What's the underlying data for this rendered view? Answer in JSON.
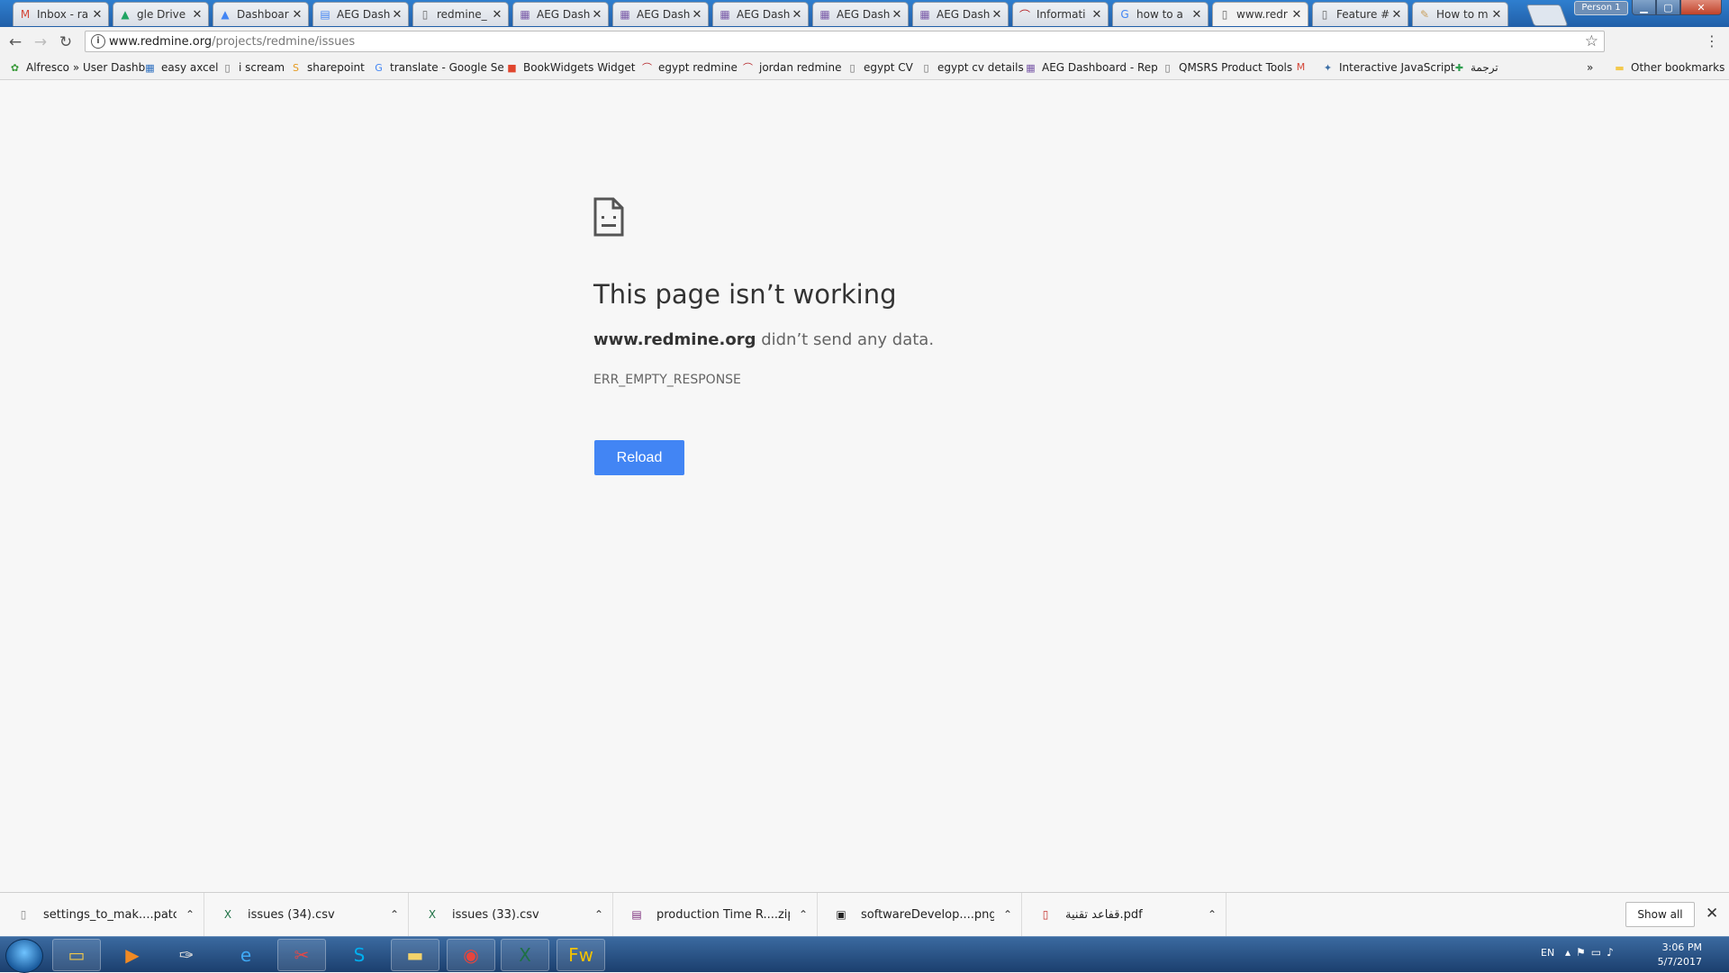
{
  "window": {
    "profile_label": "Person 1"
  },
  "tabs": [
    {
      "title": "Inbox - ra",
      "icon": "gmail-icon",
      "glyph": "M",
      "color": "#d44638",
      "active": false
    },
    {
      "title": "gle Drive",
      "icon": "google-drive-icon",
      "glyph": "▲",
      "color": "#1fa463",
      "active": false
    },
    {
      "title": "Dashboar",
      "icon": "google-drive-icon",
      "glyph": "▲",
      "color": "#4285f4",
      "active": false
    },
    {
      "title": "AEG Dash",
      "icon": "google-docs-icon",
      "glyph": "▤",
      "color": "#4285f4",
      "active": false
    },
    {
      "title": "redmine_",
      "icon": "page-icon",
      "glyph": "▯",
      "color": "#666666",
      "active": false
    },
    {
      "title": "AEG Dash",
      "icon": "dashboard-icon",
      "glyph": "▦",
      "color": "#7a5aa8",
      "active": false
    },
    {
      "title": "AEG Dash",
      "icon": "dashboard-icon",
      "glyph": "▦",
      "color": "#7a5aa8",
      "active": false
    },
    {
      "title": "AEG Dash",
      "icon": "dashboard-icon",
      "glyph": "▦",
      "color": "#7a5aa8",
      "active": false
    },
    {
      "title": "AEG Dash",
      "icon": "dashboard-icon",
      "glyph": "▦",
      "color": "#7a5aa8",
      "active": false
    },
    {
      "title": "AEG Dash",
      "icon": "dashboard-icon",
      "glyph": "▦",
      "color": "#7a5aa8",
      "active": false
    },
    {
      "title": "Informati",
      "icon": "redmine-icon",
      "glyph": "⌒",
      "color": "#b32024",
      "active": false
    },
    {
      "title": "how to a",
      "icon": "google-icon",
      "glyph": "G",
      "color": "#4285f4",
      "active": false
    },
    {
      "title": "www.redr",
      "icon": "page-icon",
      "glyph": "▯",
      "color": "#666666",
      "active": true
    },
    {
      "title": "Feature #",
      "icon": "page-icon",
      "glyph": "▯",
      "color": "#666666",
      "active": false
    },
    {
      "title": "How to m",
      "icon": "blog-icon",
      "glyph": "✎",
      "color": "#c8a060",
      "active": false
    }
  ],
  "toolbar": {
    "url_host": "www.redmine.org",
    "url_path": "/projects/redmine/issues"
  },
  "bookmarks": [
    {
      "label": "Alfresco » User Dashb",
      "icon": "alfresco-icon",
      "glyph": "✿",
      "color": "#3a9b3a"
    },
    {
      "label": "easy axcel",
      "icon": "excel-sheet-icon",
      "glyph": "▦",
      "color": "#2d6fbf"
    },
    {
      "label": "i scream",
      "icon": "page-icon",
      "glyph": "▯",
      "color": "#666666"
    },
    {
      "label": "sharepoint",
      "icon": "sharepoint-icon",
      "glyph": "S",
      "color": "#e69a1f"
    },
    {
      "label": "translate - Google Se",
      "icon": "google-icon",
      "glyph": "G",
      "color": "#4285f4"
    },
    {
      "label": "BookWidgets Widget",
      "icon": "bookwidgets-icon",
      "glyph": "■",
      "color": "#e0452d"
    },
    {
      "label": "egypt redmine",
      "icon": "redmine-icon",
      "glyph": "⌒",
      "color": "#b32024"
    },
    {
      "label": "jordan redmine",
      "icon": "redmine-icon",
      "glyph": "⌒",
      "color": "#b32024"
    },
    {
      "label": "egypt CV",
      "icon": "page-icon",
      "glyph": "▯",
      "color": "#666666"
    },
    {
      "label": "egypt cv details",
      "icon": "page-icon",
      "glyph": "▯",
      "color": "#666666"
    },
    {
      "label": "AEG Dashboard - Rep",
      "icon": "dashboard-icon",
      "glyph": "▦",
      "color": "#7a5aa8"
    },
    {
      "label": "QMSRS Product Tools",
      "icon": "page-icon",
      "glyph": "▯",
      "color": "#666666"
    },
    {
      "label": "",
      "icon": "gmail-icon",
      "glyph": "M",
      "color": "#d44638"
    },
    {
      "label": "Interactive JavaScript",
      "icon": "javascript-icon",
      "glyph": "✦",
      "color": "#3b6ea5"
    },
    {
      "label": "ترجمة",
      "icon": "translate-icon",
      "glyph": "✚",
      "color": "#2e9e4f"
    }
  ],
  "bookmarks_other": "Other bookmarks",
  "error": {
    "title": "This page isn’t working",
    "host": "www.redmine.org",
    "desc_rest": " didn’t send any data.",
    "code": "ERR_EMPTY_RESPONSE",
    "reload_label": "Reload"
  },
  "downloads": [
    {
      "name": "settings_to_mak....patch",
      "icon": "file-icon",
      "glyph": "▯",
      "color": "#888888"
    },
    {
      "name": "issues (34).csv",
      "icon": "csv-file-icon",
      "glyph": "X",
      "color": "#1e7145"
    },
    {
      "name": "issues (33).csv",
      "icon": "csv-file-icon",
      "glyph": "X",
      "color": "#1e7145"
    },
    {
      "name": "production Time R....zip",
      "icon": "zip-file-icon",
      "glyph": "▤",
      "color": "#7b2c7b"
    },
    {
      "name": "softwareDevelop....png",
      "icon": "image-file-icon",
      "glyph": "▣",
      "color": "#222222"
    },
    {
      "name": "قفاعد تقنية.pdf",
      "icon": "pdf-file-icon",
      "glyph": "▯",
      "color": "#c4302b"
    }
  ],
  "shelf": {
    "show_all_label": "Show all"
  },
  "taskbar": {
    "apps": [
      {
        "name": "explorer-icon",
        "glyph": "▭",
        "color": "#f1c84b",
        "open": true
      },
      {
        "name": "media-player-icon",
        "glyph": "▶",
        "color": "#f08a24",
        "open": false
      },
      {
        "name": "tool-icon",
        "glyph": "✑",
        "color": "#d9d9d9",
        "open": false
      },
      {
        "name": "internet-explorer-icon",
        "glyph": "e",
        "color": "#3fa9f5",
        "open": false
      },
      {
        "name": "snipping-tool-icon",
        "glyph": "✂",
        "color": "#e04848",
        "open": true
      },
      {
        "name": "skype-icon",
        "glyph": "S",
        "color": "#00aff0",
        "open": false
      },
      {
        "name": "folder-icon",
        "glyph": "▬",
        "color": "#f3d36b",
        "open": true
      },
      {
        "name": "chrome-icon",
        "glyph": "◉",
        "color": "#e8453c",
        "open": true
      },
      {
        "name": "excel-icon",
        "glyph": "X",
        "color": "#1e7145",
        "open": true
      },
      {
        "name": "fireworks-icon",
        "glyph": "Fw",
        "color": "#f2c200",
        "open": true
      }
    ],
    "language": "EN",
    "time": "3:06 PM",
    "date": "5/7/2017"
  }
}
